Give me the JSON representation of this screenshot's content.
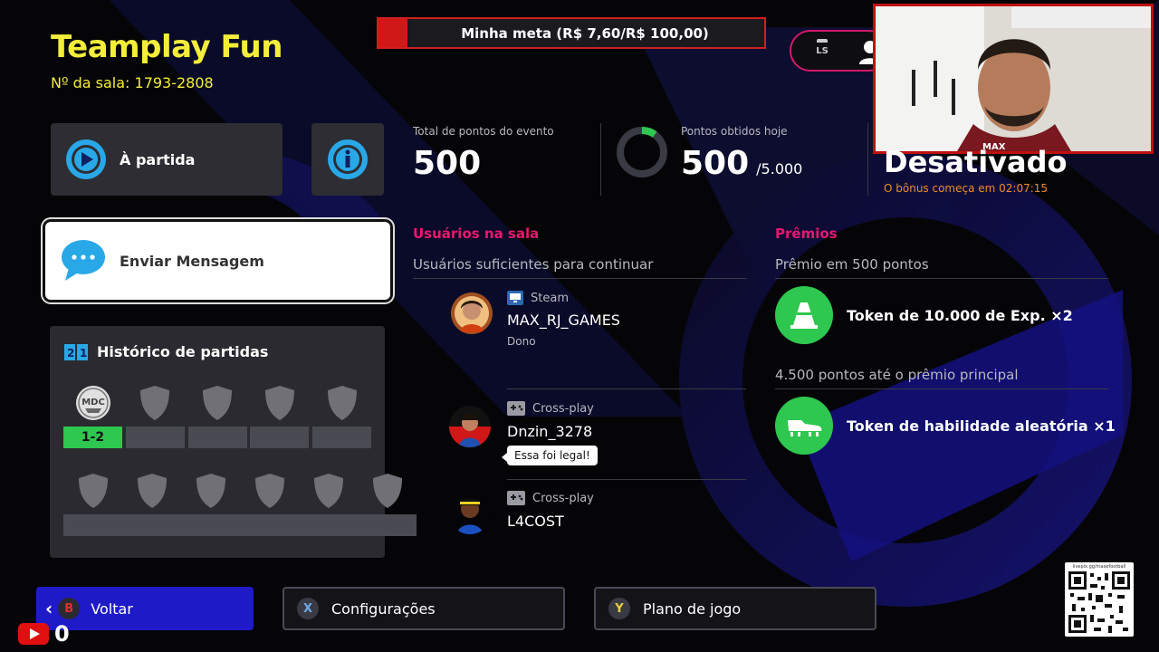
{
  "header": {
    "title": "Teamplay Fun",
    "room_label": "Nº da sala: 1793-2808",
    "goal_text": "Minha meta (R$ 7,60/R$ 100,00)",
    "goal_progress": 0.076,
    "ls_label": "LS"
  },
  "actions": {
    "to_match": "À partida",
    "send_message": "Enviar Mensagem"
  },
  "stats": {
    "event_total_label": "Total de pontos do evento",
    "event_total_value": "500",
    "today_label": "Pontos obtidos hoje",
    "today_value": "500",
    "today_max": "/5.000",
    "today_progress": 0.1,
    "bonus_status": "Desativado",
    "bonus_countdown": "O bônus começa em 02:07:15"
  },
  "history": {
    "title": "Histórico de partidas",
    "score": "1-2",
    "first_badge": "MDC"
  },
  "users": {
    "title": "Usuários na sala",
    "subtitle": "Usuários suficientes para continuar",
    "list": [
      {
        "platform": "Steam",
        "name": "MAX_RJ_GAMES",
        "role": "Dono"
      },
      {
        "platform": "Cross-play",
        "name": "Dnzin_3278",
        "bubble": "Essa foi legal!"
      },
      {
        "platform": "Cross-play",
        "name": "L4COST"
      }
    ]
  },
  "prizes": {
    "title": "Prêmios",
    "first_threshold": "Prêmio em 500 pontos",
    "first_prize": "Token de 10.000 de Exp. ×2",
    "main_threshold": "4.500 pontos até o prêmio principal",
    "main_prize": "Token de habilidade aleatória ×1"
  },
  "footer": {
    "back_key": "B",
    "back_label": "Voltar",
    "settings_key": "X",
    "settings_label": "Configurações",
    "plan_key": "Y",
    "plan_label": "Plano de jogo"
  },
  "overlay": {
    "webcam_text": "MAX",
    "youtube_count": "0",
    "qr_url": "livepix.gg/maxefootball"
  },
  "colors": {
    "title_yellow": "#f4ee3a",
    "accent_pink": "#e8186f",
    "accent_green": "#2ec74f",
    "accent_blue": "#1f1ac8",
    "goal_red": "#d01818"
  }
}
